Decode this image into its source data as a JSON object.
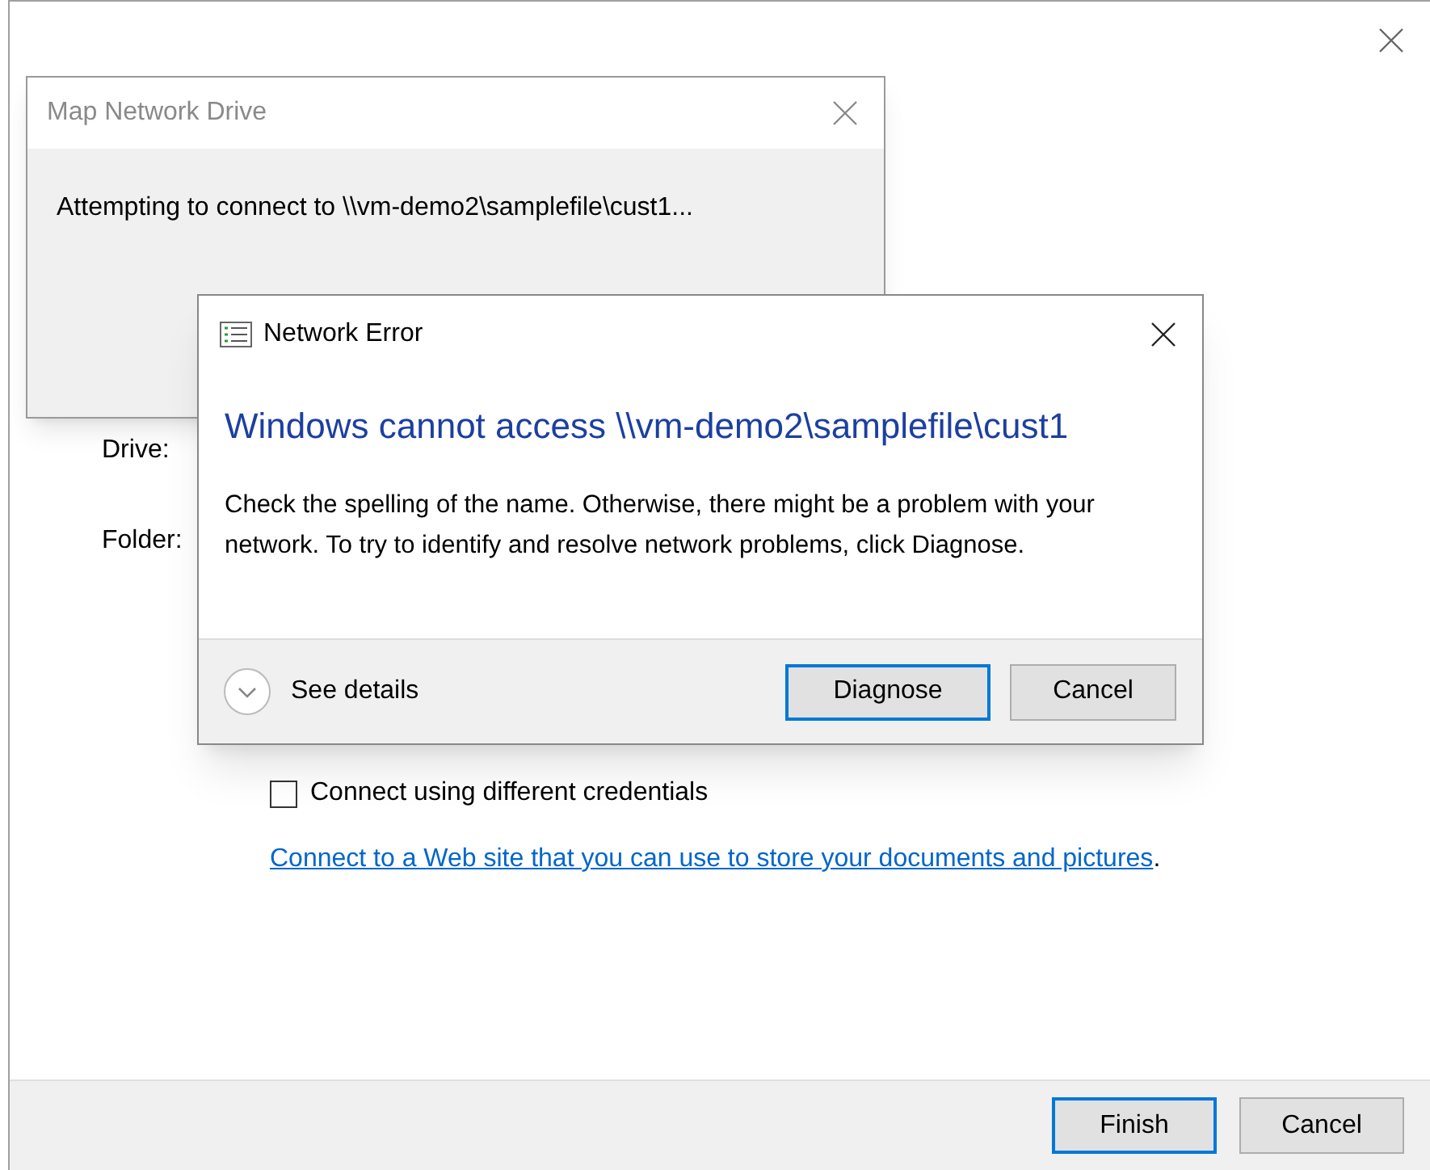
{
  "wizard": {
    "fields": [
      {
        "label": "Drive:"
      },
      {
        "label": "Folder:"
      }
    ],
    "credentials_option": {
      "label": "Connect using different credentials",
      "checked": false
    },
    "link": {
      "text": "Connect to a Web site that you can use to store your documents and pictures",
      "suffix": "."
    },
    "buttons": [
      {
        "label": "Finish",
        "default": true
      },
      {
        "label": "Cancel",
        "default": false
      }
    ]
  },
  "progress_dialog": {
    "title": "Map Network Drive",
    "message": "Attempting to connect to \\\\vm-demo2\\samplefile\\cust1..."
  },
  "error_dialog": {
    "title": "Network Error",
    "heading": "Windows cannot access \\\\vm-demo2\\samplefile\\cust1",
    "message": "Check the spelling of the name. Otherwise, there might be a problem with your network. To try to identify and resolve network problems, click Diagnose.",
    "details": {
      "label": "See details",
      "expanded": false
    },
    "buttons": [
      {
        "label": "Diagnose",
        "default": true
      },
      {
        "label": "Cancel",
        "default": false
      }
    ]
  }
}
